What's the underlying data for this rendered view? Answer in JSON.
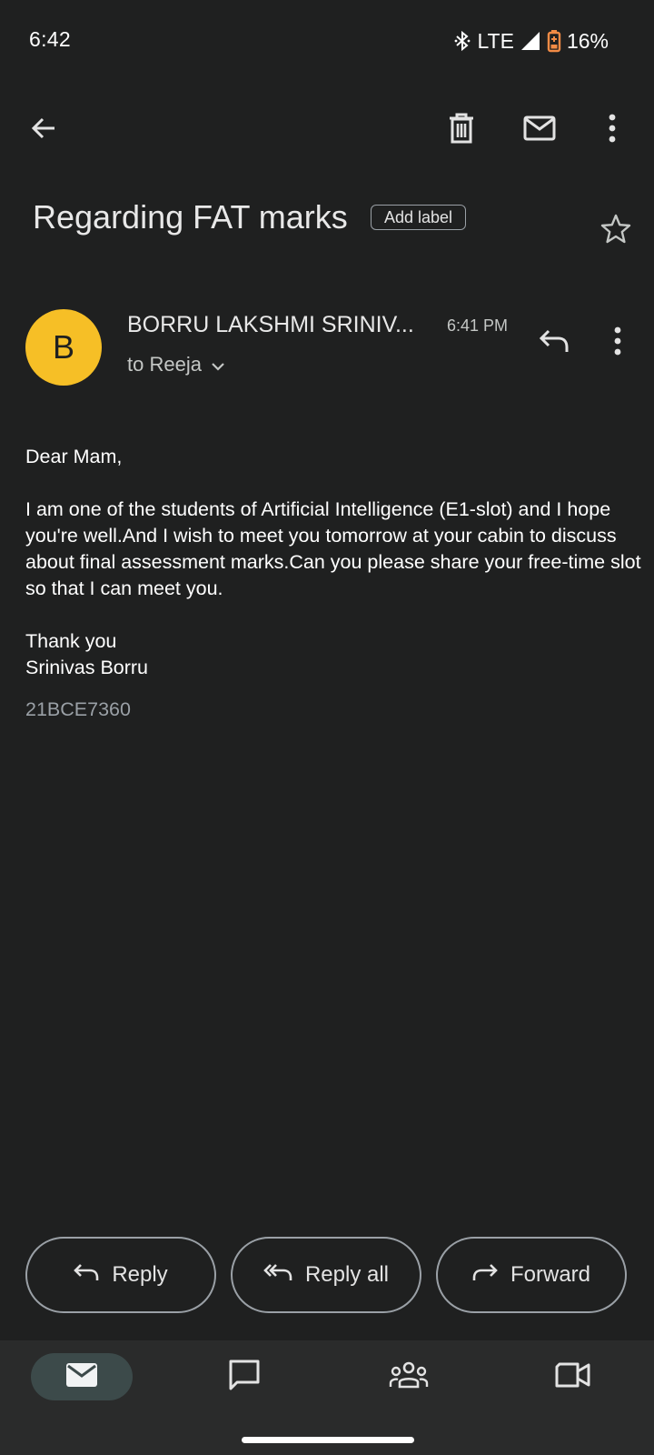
{
  "status": {
    "time": "6:42",
    "network": "LTE",
    "battery": "16%"
  },
  "icons": {
    "back": "arrow-back-icon",
    "delete": "trash-icon",
    "mark_unread": "mail-icon",
    "more": "more-vert-icon",
    "star": "star-outline-icon",
    "reply": "reply-icon",
    "reply_all": "reply-all-icon",
    "forward": "forward-icon"
  },
  "email": {
    "subject": "Regarding FAT marks",
    "add_label": "Add label",
    "avatar_letter": "B",
    "avatar_color": "#f6bf26",
    "sender": "BORRU LAKSHMI SRINIV...",
    "time": "6:41 PM",
    "recipients": "to Reeja",
    "body": {
      "greeting": "Dear Mam,",
      "paragraph": "I am one of the students of Artificial Intelligence (E1-slot) and I hope you're well.And I wish to meet you tomorrow at your cabin to discuss about final assessment marks.Can you please share your free-time slot so that I can meet you.",
      "closing": "Thank you",
      "name": "Srinivas Borru"
    },
    "signature": "21BCE7360"
  },
  "actions": {
    "reply": "Reply",
    "reply_all": "Reply all",
    "forward": "Forward"
  },
  "nav": {
    "active": "mail",
    "active_color": "#3c4a4a",
    "items": [
      "mail",
      "chat",
      "spaces",
      "meet"
    ]
  }
}
